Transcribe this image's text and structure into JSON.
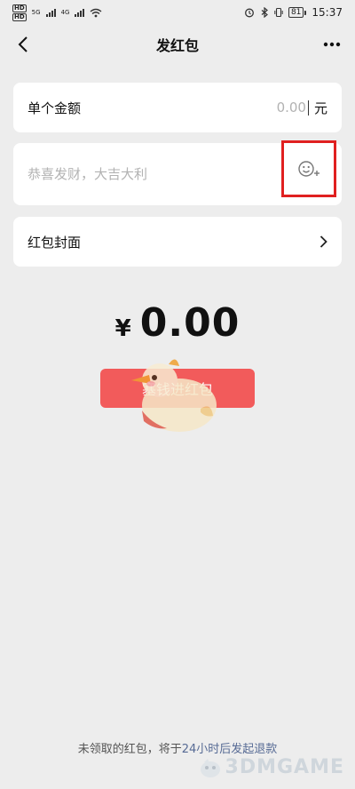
{
  "status_bar": {
    "hd_labels": [
      "HD",
      "HD"
    ],
    "network_labels": [
      "5G",
      "4G"
    ],
    "battery": "81",
    "time": "15:37"
  },
  "nav": {
    "title": "发红包"
  },
  "amount_row": {
    "label": "单个金额",
    "placeholder": "0.00",
    "unit": "元"
  },
  "greeting": {
    "placeholder": "恭喜发财，大吉大利"
  },
  "cover_row": {
    "label": "红包封面"
  },
  "total": {
    "currency": "¥",
    "value": "0.00"
  },
  "submit_button": {
    "label": "塞钱进红包"
  },
  "footer": {
    "text_prefix": "未领取的红包，将于",
    "text_highlight": "24小时后发起退款"
  },
  "watermark": {
    "text": "3DMGAME"
  },
  "colors": {
    "background": "#ededed",
    "button_red": "#f25b5b",
    "highlight_box": "#e02020",
    "link_blue": "#576b95"
  }
}
